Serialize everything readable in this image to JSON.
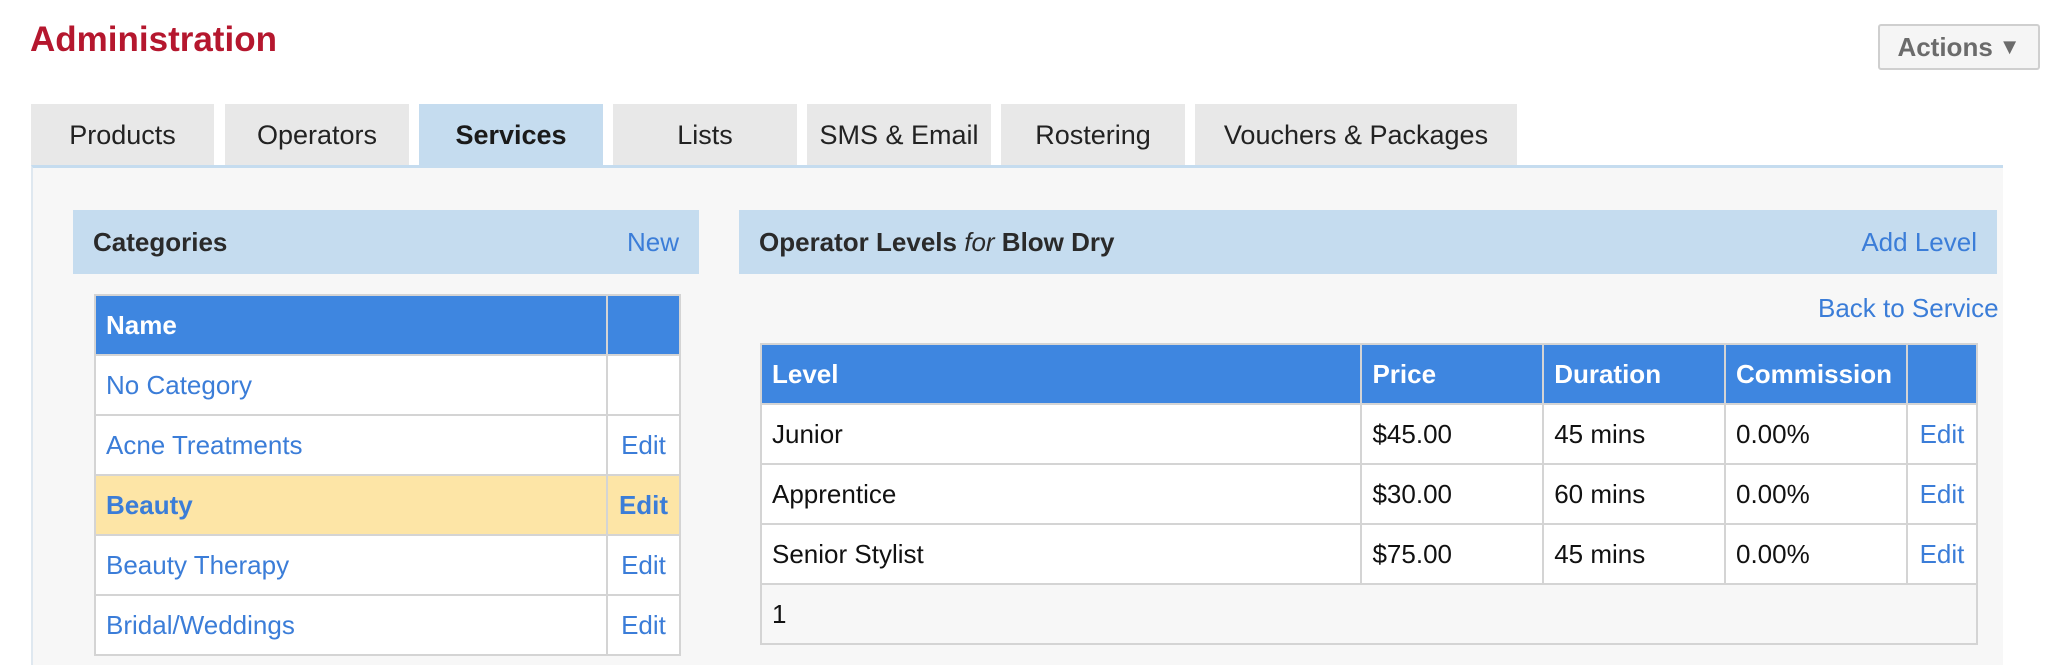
{
  "page": {
    "title": "Administration",
    "actions_label": "Actions",
    "actions_icon": "triangle-down-icon"
  },
  "tabs": [
    {
      "label": "Products",
      "active": false
    },
    {
      "label": "Operators",
      "active": false
    },
    {
      "label": "Services",
      "active": true
    },
    {
      "label": "Lists",
      "active": false
    },
    {
      "label": "SMS & Email",
      "active": false
    },
    {
      "label": "Rostering",
      "active": false
    },
    {
      "label": "Vouchers & Packages",
      "active": false
    }
  ],
  "categories": {
    "title": "Categories",
    "new_label": "New",
    "columns": [
      "Name",
      ""
    ],
    "rows": [
      {
        "name": "No Category",
        "edit": ""
      },
      {
        "name": "Acne Treatments",
        "edit": "Edit"
      },
      {
        "name": "Beauty",
        "edit": "Edit",
        "selected": true
      },
      {
        "name": "Beauty Therapy",
        "edit": "Edit"
      },
      {
        "name": "Bridal/Weddings",
        "edit": "Edit"
      }
    ]
  },
  "levels": {
    "title_prefix": "Operator Levels",
    "title_for": "for",
    "service_name": "Blow Dry",
    "add_label": "Add Level",
    "back_label": "Back to Service",
    "columns": [
      "Level",
      "Price",
      "Duration",
      "Commission",
      ""
    ],
    "rows": [
      {
        "level": "Junior",
        "price": "$45.00",
        "duration": "45 mins",
        "commission": "0.00%",
        "edit": "Edit"
      },
      {
        "level": "Apprentice",
        "price": "$30.00",
        "duration": "60 mins",
        "commission": "0.00%",
        "edit": "Edit"
      },
      {
        "level": "Senior Stylist",
        "price": "$75.00",
        "duration": "45 mins",
        "commission": "0.00%",
        "edit": "Edit"
      }
    ],
    "pager": "1"
  },
  "colors": {
    "brand": "#b5172e",
    "tab_active": "#c5dcef",
    "table_header": "#3e86e0",
    "link": "#3b7dd8",
    "selected_row": "#fde5a6"
  }
}
